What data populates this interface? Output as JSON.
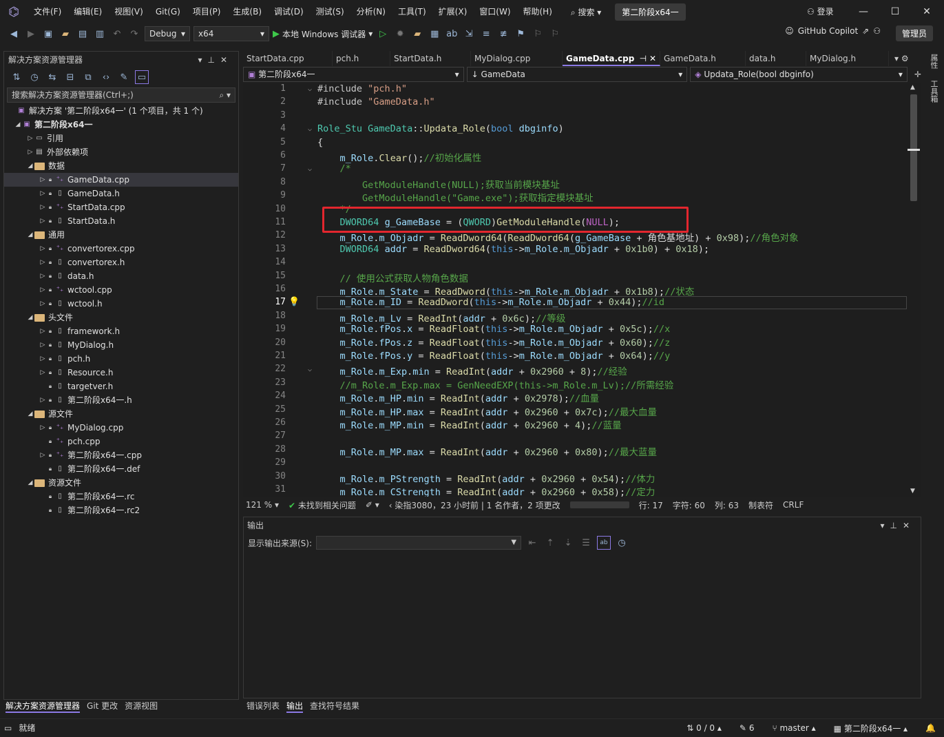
{
  "menubar": {
    "items": [
      "文件(F)",
      "编辑(E)",
      "视图(V)",
      "Git(G)",
      "项目(P)",
      "生成(B)",
      "调试(D)",
      "测试(S)",
      "分析(N)",
      "工具(T)",
      "扩展(X)",
      "窗口(W)",
      "帮助(H)"
    ],
    "search": "搜索",
    "title": "第二阶段x64一",
    "login": "登录"
  },
  "toolbar": {
    "config": "Debug",
    "platform": "x64",
    "run_label": "本地 Windows 调试器",
    "copilot": "GitHub Copilot",
    "admin": "管理员"
  },
  "solution_explorer": {
    "title": "解决方案资源管理器",
    "search_placeholder": "搜索解决方案资源管理器(Ctrl+;)",
    "tree": [
      {
        "label": "解决方案 '第二阶段x64一' (1 个项目，共 1 个)",
        "depth": 0,
        "kind": "solution"
      },
      {
        "label": "第二阶段x64一",
        "depth": 1,
        "kind": "project",
        "bold": true
      },
      {
        "label": "引用",
        "depth": 2,
        "kind": "ref"
      },
      {
        "label": "外部依赖项",
        "depth": 2,
        "kind": "ext"
      },
      {
        "label": "数据",
        "depth": 2,
        "kind": "folder"
      },
      {
        "label": "GameData.cpp",
        "depth": 3,
        "kind": "cpp",
        "selected": true
      },
      {
        "label": "GameData.h",
        "depth": 3,
        "kind": "h"
      },
      {
        "label": "StartData.cpp",
        "depth": 3,
        "kind": "cpp"
      },
      {
        "label": "StartData.h",
        "depth": 3,
        "kind": "h"
      },
      {
        "label": "通用",
        "depth": 2,
        "kind": "folder"
      },
      {
        "label": "convertorex.cpp",
        "depth": 3,
        "kind": "cpp"
      },
      {
        "label": "convertorex.h",
        "depth": 3,
        "kind": "h"
      },
      {
        "label": "data.h",
        "depth": 3,
        "kind": "h"
      },
      {
        "label": "wctool.cpp",
        "depth": 3,
        "kind": "cpp"
      },
      {
        "label": "wctool.h",
        "depth": 3,
        "kind": "h"
      },
      {
        "label": "头文件",
        "depth": 2,
        "kind": "folder"
      },
      {
        "label": "framework.h",
        "depth": 3,
        "kind": "h"
      },
      {
        "label": "MyDialog.h",
        "depth": 3,
        "kind": "h"
      },
      {
        "label": "pch.h",
        "depth": 3,
        "kind": "h"
      },
      {
        "label": "Resource.h",
        "depth": 3,
        "kind": "h"
      },
      {
        "label": "targetver.h",
        "depth": 3,
        "kind": "h"
      },
      {
        "label": "第二阶段x64一.h",
        "depth": 3,
        "kind": "h"
      },
      {
        "label": "源文件",
        "depth": 2,
        "kind": "folder"
      },
      {
        "label": "MyDialog.cpp",
        "depth": 3,
        "kind": "cpp"
      },
      {
        "label": "pch.cpp",
        "depth": 3,
        "kind": "cpp"
      },
      {
        "label": "第二阶段x64一.cpp",
        "depth": 3,
        "kind": "cpp"
      },
      {
        "label": "第二阶段x64一.def",
        "depth": 3,
        "kind": "def"
      },
      {
        "label": "资源文件",
        "depth": 2,
        "kind": "folder"
      },
      {
        "label": "第二阶段x64一.rc",
        "depth": 3,
        "kind": "rc"
      },
      {
        "label": "第二阶段x64一.rc2",
        "depth": 3,
        "kind": "rc"
      }
    ],
    "bottom_tabs": [
      "解决方案资源管理器",
      "Git 更改",
      "资源视图"
    ]
  },
  "doc_tabs": [
    "StartData.cpp",
    "pch.h",
    "StartData.h",
    "MyDialog.cpp",
    "GameData.cpp",
    "GameData.h",
    "data.h",
    "MyDialog.h"
  ],
  "active_tab": "GameData.cpp",
  "navbar": {
    "project": "第二阶段x64一",
    "scope": "GameData",
    "member": "Updata_Role(bool dbginfo)"
  },
  "editor": {
    "current_line": 17
  },
  "editor_status": {
    "zoom": "121 %",
    "issues": "未找到相关问题",
    "git_blame": "染指3080，23 小时前 | 1 名作者，2 项更改",
    "line": "行: 17",
    "char": "字符: 60",
    "col": "列: 63",
    "tabs": "制表符",
    "eol": "CRLF"
  },
  "output": {
    "title": "输出",
    "source_label": "显示输出来源(S):",
    "bottom_tabs": [
      "错误列表",
      "输出",
      "查找符号结果"
    ]
  },
  "right_rail": [
    "属性",
    "工具箱"
  ],
  "statusbar": {
    "ready": "就绪",
    "changes": "0 / 0",
    "edits": "6",
    "branch": "master",
    "repo": "第二阶段x64一"
  }
}
